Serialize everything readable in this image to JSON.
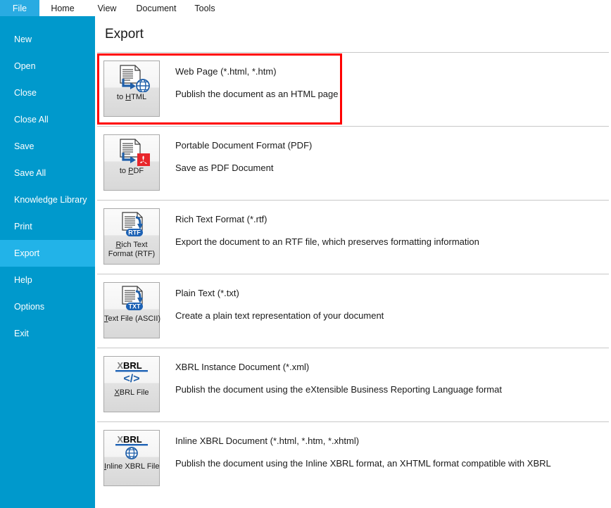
{
  "tabs": [
    {
      "label": "File",
      "key": "file",
      "active": true
    },
    {
      "label": "Home",
      "key": "home",
      "active": false
    },
    {
      "label": "View",
      "key": "view",
      "active": false
    },
    {
      "label": "Document",
      "key": "doc",
      "active": false
    },
    {
      "label": "Tools",
      "key": "tools",
      "active": false
    }
  ],
  "sidebar": {
    "items": [
      {
        "label": "New",
        "active": false
      },
      {
        "label": "Open",
        "active": false
      },
      {
        "label": "Close",
        "active": false
      },
      {
        "label": "Close All",
        "active": false
      },
      {
        "label": "Save",
        "active": false
      },
      {
        "label": "Save All",
        "active": false
      },
      {
        "label": "Knowledge Library",
        "active": false
      },
      {
        "label": "Print",
        "active": false
      },
      {
        "label": "Export",
        "active": true
      },
      {
        "label": "Help",
        "active": false
      },
      {
        "label": "Options",
        "active": false
      },
      {
        "label": "Exit",
        "active": false
      }
    ]
  },
  "main": {
    "title": "Export",
    "options": [
      {
        "id": "html",
        "button_line1_pre": "to ",
        "button_line1_accel": "H",
        "button_line1_post": "TML",
        "button_line2": "",
        "icon": "document-to-globe-icon",
        "title": "Web Page (*.html, *.htm)",
        "description": "Publish the document as an HTML page",
        "highlighted": true
      },
      {
        "id": "pdf",
        "button_line1_pre": "to ",
        "button_line1_accel": "P",
        "button_line1_post": "DF",
        "button_line2": "",
        "icon": "document-to-pdf-icon",
        "title": "Portable Document Format (PDF)",
        "description": "Save as PDF Document",
        "highlighted": false
      },
      {
        "id": "rtf",
        "button_line1_pre": "",
        "button_line1_accel": "R",
        "button_line1_post": "ich Text",
        "button_line2": "Format (RTF)",
        "icon": "document-rtf-icon",
        "title": "Rich Text Format (*.rtf)",
        "description": "Export the document to an RTF file, which preserves formatting information",
        "highlighted": false
      },
      {
        "id": "txt",
        "button_line1_pre": "",
        "button_line1_accel": "T",
        "button_line1_post": "ext File (ASCII)",
        "button_line2": "",
        "icon": "document-txt-icon",
        "title": "Plain Text (*.txt)",
        "description": "Create a plain text representation of your document",
        "highlighted": false
      },
      {
        "id": "xbrl",
        "button_line1_pre": "",
        "button_line1_accel": "X",
        "button_line1_post": "BRL File",
        "button_line2": "",
        "icon": "xbrl-code-icon",
        "title": "XBRL Instance Document (*.xml)",
        "description": "Publish the document using the eXtensible Business Reporting Language format",
        "highlighted": false
      },
      {
        "id": "ixbrl",
        "button_line1_pre": "",
        "button_line1_accel": "I",
        "button_line1_post": "nline XBRL File",
        "button_line2": "",
        "icon": "xbrl-globe-icon",
        "title": "Inline XBRL Document (*.html, *.htm, *.xhtml)",
        "description": "Publish the document using the Inline XBRL format, an XHTML format compatible with XBRL",
        "highlighted": false
      }
    ]
  },
  "colors": {
    "sidebar_bg": "#0099cc",
    "sidebar_active": "#22b3e8",
    "tab_file_bg": "#29abe2",
    "highlight_border": "#ff0000",
    "rule": "#c8c8c8",
    "icon_blue": "#1f5fa9",
    "pdf_red": "#e8252a",
    "badge_blue": "#1d62b5"
  }
}
